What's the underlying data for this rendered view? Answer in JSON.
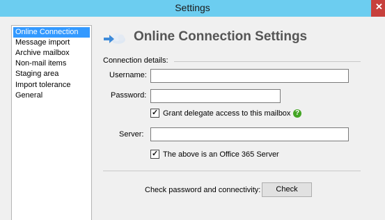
{
  "window": {
    "title": "Settings",
    "close_icon": "close-icon"
  },
  "sidebar": {
    "items": [
      {
        "label": "Online Connection",
        "selected": true
      },
      {
        "label": "Message import",
        "selected": false
      },
      {
        "label": "Archive mailbox",
        "selected": false
      },
      {
        "label": "Non-mail items",
        "selected": false
      },
      {
        "label": "Staging area",
        "selected": false
      },
      {
        "label": "Import tolerance",
        "selected": false
      },
      {
        "label": "General",
        "selected": false
      }
    ]
  },
  "header": {
    "title": "Online Connection Settings",
    "icon": "cloud-connect-icon"
  },
  "connection": {
    "group_label": "Connection details:",
    "username_label": "Username:",
    "username_value": "",
    "password_label": "Password:",
    "password_value": "",
    "grant_delegate_label": "Grant delegate access to this mailbox",
    "grant_delegate_checked": true,
    "help_icon": "help-icon",
    "server_label": "Server:",
    "server_value": "",
    "office365_label": "The above is an Office 365 Server",
    "office365_checked": true
  },
  "check": {
    "label": "Check password and connectivity:",
    "button_label": "Check"
  },
  "colors": {
    "titlebar": "#6ccdf0",
    "close_button": "#c7403c",
    "selection": "#3399ff",
    "help_icon": "#43a524"
  }
}
